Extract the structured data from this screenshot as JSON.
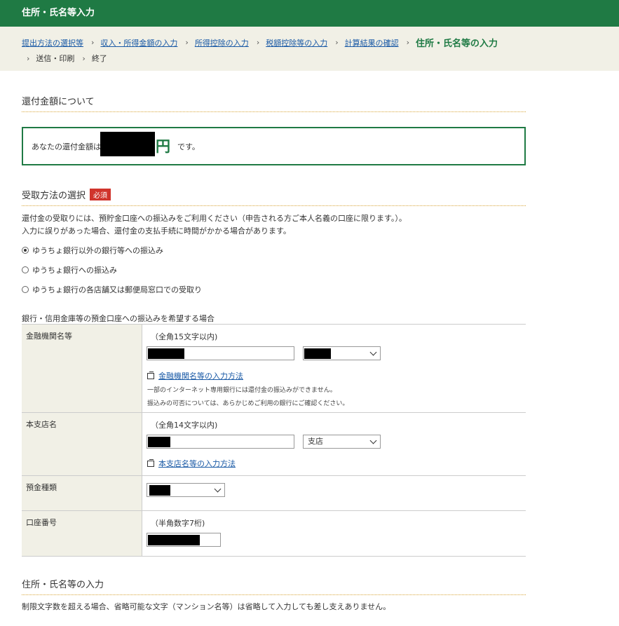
{
  "header": {
    "title": "住所・氏名等入力"
  },
  "breadcrumb": {
    "steps": [
      {
        "label": "提出方法の選択等"
      },
      {
        "label": "収入・所得金額の入力"
      },
      {
        "label": "所得控除の入力"
      },
      {
        "label": "税額控除等の入力"
      },
      {
        "label": "計算結果の確認"
      },
      {
        "label": "住所・氏名等の入力"
      },
      {
        "label": "送信・印刷"
      },
      {
        "label": "終了"
      }
    ]
  },
  "refund": {
    "section_title": "還付金額について",
    "text_prefix": "あなたの還付金額は",
    "unit": "円",
    "text_suffix": "です。"
  },
  "receipt": {
    "section_title": "受取方法の選択",
    "required_badge": "必須",
    "description_1": "還付金の受取りには、預貯金口座への振込みをご利用ください（申告される方ご本人名義の口座に限ります。）。",
    "description_2": "入力に誤りがあった場合、還付金の支払手続に時間がかかる場合があります。",
    "options": [
      {
        "label": "ゆうちょ銀行以外の銀行等への振込み",
        "selected": true
      },
      {
        "label": "ゆうちょ銀行への振込み",
        "selected": false
      },
      {
        "label": "ゆうちょ銀行の各店舗又は郵便局窓口での受取り",
        "selected": false
      }
    ]
  },
  "bank_table": {
    "caption": "銀行・信用金庫等の預金口座への振込みを希望する場合",
    "institution": {
      "label": "金融機関名等",
      "hint": "（全角15文字以内)",
      "help_link": "金融機関名等の入力方法",
      "note_1": "一部のインターネット専用銀行には還付金の振込みができません。",
      "note_2": "振込みの可否については、あらかじめご利用の銀行にご確認ください。"
    },
    "branch": {
      "label": "本支店名",
      "hint": "（全角14文字以内)",
      "select_value": "支店",
      "help_link": "本支店名等の入力方法"
    },
    "deposit_type": {
      "label": "預金種類"
    },
    "account_number": {
      "label": "口座番号",
      "hint": "（半角数字7桁)"
    }
  },
  "address": {
    "section_title": "住所・氏名等の入力",
    "description": "制限文字数を超える場合、省略可能な文字（マンション名等）は省略して入力しても差し支えありません。"
  }
}
